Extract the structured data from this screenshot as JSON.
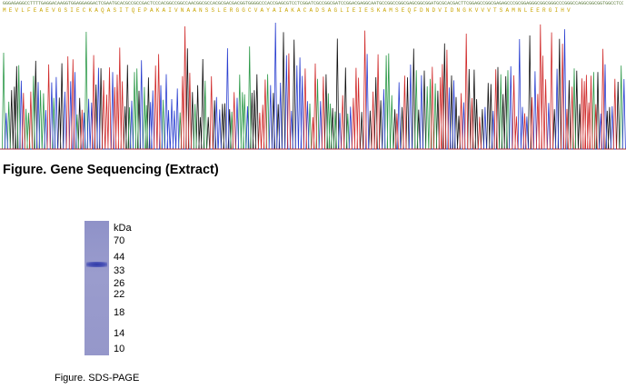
{
  "sequencing": {
    "dna_text": "GGGAGAGGCCTTTTGAGGACAAGGTGGAGGAGGACTCGAATGCACGCCGCCGACTCCCACGGCCGGCCAACGGCGCCACGCGACGACGGTGGGGCCCACCGAGCGTCCTCGGATCGCCGGCGATCCGGACGAGGCAATGCCGGCCGGCGAGCGGCGGATGCGCACGACTTCGGAGCCGGCGAGAGCCCGCGGAGGGCGGCGGGCCCGGGCCAGGCGGCGGTGGCCTCCGCGTCCGGGGCCGGCGACGCGCGGGGCAGCCGCGCCGGCGGCTGGTGGCGGCCCGGCGCCGGCGGCCTGTCGC",
    "aa_text": "MEVLFEAEVGSIECKAQASITQEPAKAIVNAANSSLERGGCVAYAIAKACADSAGLIEIESKAMSEQFDNDVIDNGKVVVTSAMNLEERGIHV",
    "caption": "Figure. Gene Sequencing (Extract)"
  },
  "gel": {
    "unit_label": "kDa",
    "markers": [
      {
        "label": "70",
        "kda": 70
      },
      {
        "label": "44",
        "kda": 44
      },
      {
        "label": "33",
        "kda": 33
      },
      {
        "label": "26",
        "kda": 26
      },
      {
        "label": "22",
        "kda": 22
      },
      {
        "label": "18",
        "kda": 18
      },
      {
        "label": "14",
        "kda": 14
      },
      {
        "label": "10",
        "kda": 10
      }
    ],
    "caption": "Figure. SDS-PAGE"
  },
  "colors": {
    "trace_a": "#2e9a4a",
    "trace_c": "#2a3fd0",
    "trace_g": "#111111",
    "trace_t": "#d02a2a",
    "gel_lane": "#9597ca",
    "gel_band": "#2f3aa8"
  }
}
